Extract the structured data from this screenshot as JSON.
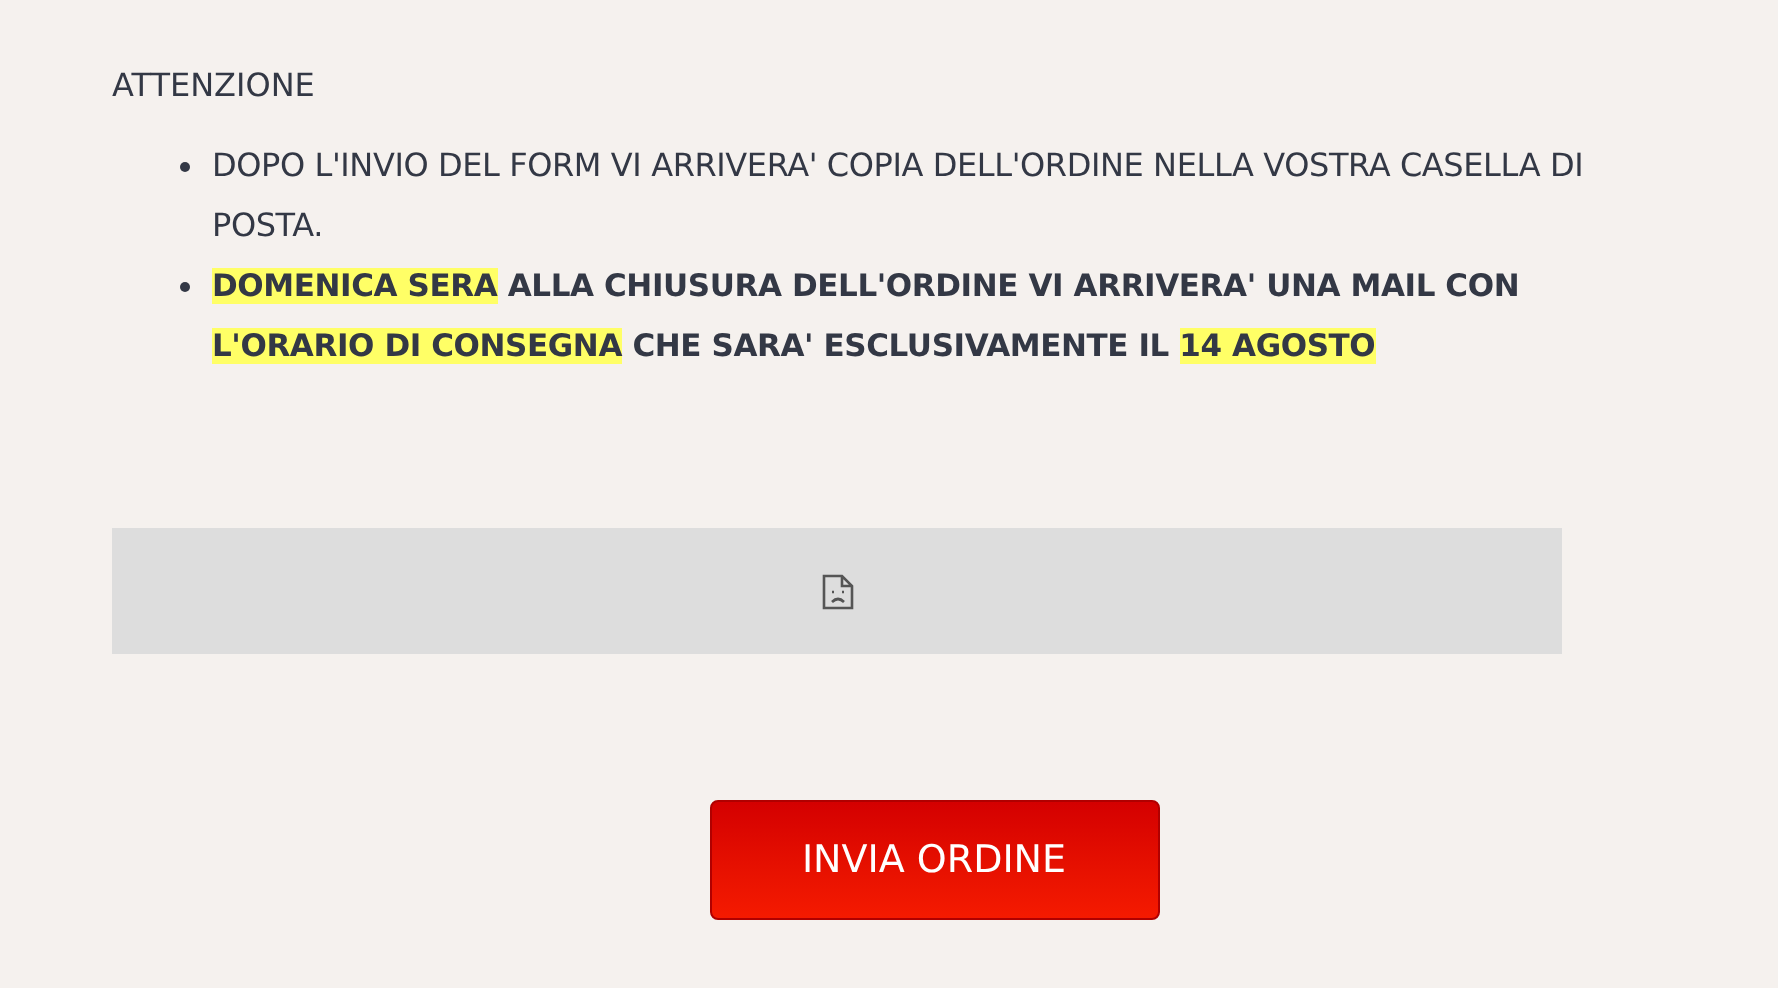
{
  "heading": "ATTENZIONE",
  "bullets": [
    {
      "bold": false,
      "segments": [
        {
          "text": "DOPO L'INVIO DEL FORM VI ARRIVERA' COPIA DELL'ORDINE NELLA VOSTRA CASELLA DI POSTA.",
          "highlighted": false
        }
      ]
    },
    {
      "bold": true,
      "segments": [
        {
          "text": "DOMENICA SERA",
          "highlighted": true
        },
        {
          "text": " ALLA CHIUSURA DELL'ORDINE VI ARRIVERA' UNA MAIL CON ",
          "highlighted": false
        },
        {
          "text": "L'ORARIO DI CONSEGNA",
          "highlighted": true
        },
        {
          "text": " CHE SARA' ESCLUSIVAMENTE IL ",
          "highlighted": false
        },
        {
          "text": "14 AGOSTO",
          "highlighted": true
        }
      ]
    }
  ],
  "embed": {
    "kind": "broken-image"
  },
  "submit_button": "INVIA ORDINE"
}
